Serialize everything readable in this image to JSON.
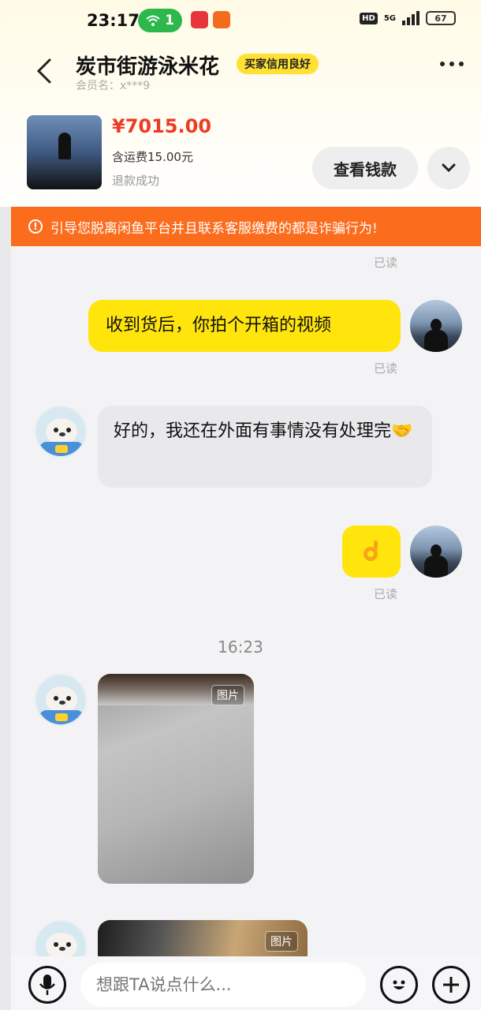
{
  "status_bar": {
    "time": "23:17",
    "wifi_count": "1",
    "network": "5G",
    "hd": "HD",
    "battery": "67"
  },
  "header": {
    "title": "炭市街游泳米花",
    "badge": "买家信用良好",
    "member_label": "会员名：",
    "member_name": "x***9"
  },
  "product": {
    "price": "¥7015.00",
    "shipping": "含运费15.00元",
    "status": "退款成功",
    "wallet_button": "查看钱款"
  },
  "warning": {
    "text": "引导您脱离闲鱼平台并且联系客服缴费的都是诈骗行为!"
  },
  "chat": {
    "read_label": "已读",
    "msg_out_1": "收到货后，你拍个开箱的视频",
    "msg_in_1": "好的，我还在外面有事情没有处理完🤝",
    "timestamp": "16:23",
    "image_tag": "图片"
  },
  "input": {
    "placeholder": "想跟TA说点什么..."
  },
  "colors": {
    "accent_yellow": "#ffe50c",
    "warning_orange": "#fb6c1d",
    "price_red": "#ee3b24"
  }
}
